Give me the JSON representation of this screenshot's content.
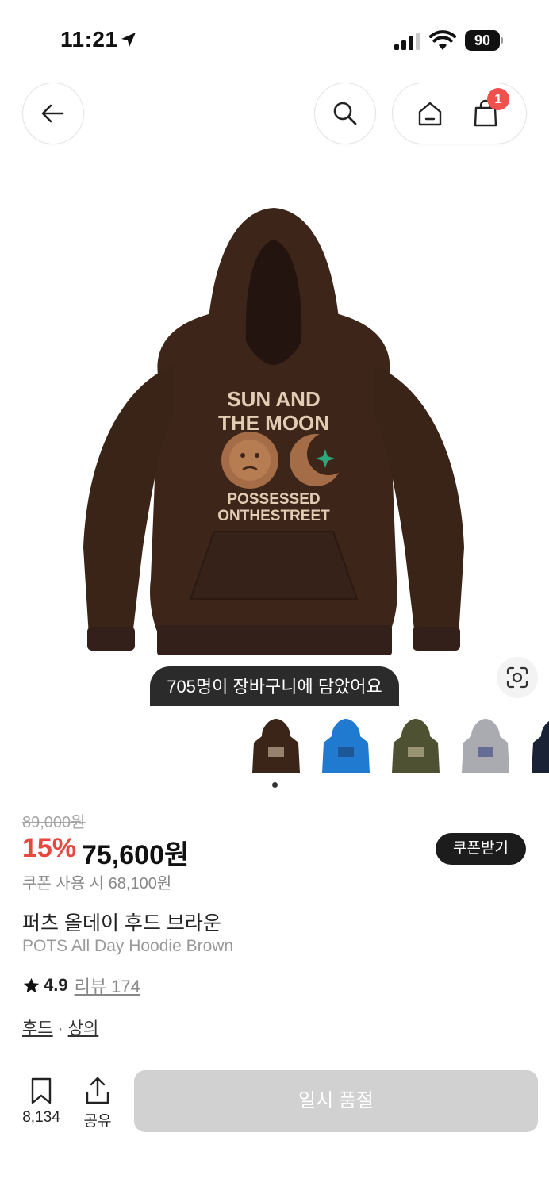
{
  "status_bar": {
    "time": "11:21",
    "battery": "90"
  },
  "nav": {
    "cart_badge": "1"
  },
  "product": {
    "cart_count_notice": "705명이 장바구니에 담았어요",
    "thumbnail_colors": [
      "#3b2519",
      "#1f7ad0",
      "#4e5233",
      "#a9abb0",
      "#1a2236"
    ],
    "selected_image_index": 0,
    "original_price": "89,000원",
    "discount_rate": "15%",
    "sale_price": "75,600원",
    "coupon_button": "쿠폰받기",
    "coupon_price": "쿠폰 사용 시 68,100원",
    "name_ko": "퍼츠 올데이 후드 브라운",
    "name_en": "POTS All Day Hoodie Brown",
    "rating": "4.9",
    "review_label": "리뷰 174",
    "categories": [
      "후드",
      "상의"
    ],
    "category_separator": "·",
    "print_text": {
      "line1": "SUN AND",
      "line2": "THE MOON",
      "line3": "POSSESSED",
      "line4": "ONTHESTREET"
    }
  },
  "bottom_bar": {
    "bookmark_count": "8,134",
    "share_label": "공유",
    "soldout_label": "일시 품절"
  },
  "colors": {
    "hoodie_brown": "#3d2519",
    "discount_red": "#e8463e",
    "badge_red": "#f0514d",
    "print_beige": "#e2cdb4",
    "sun_tan": "#a56d47",
    "star_green": "#2ea67c",
    "disabled_gray": "#d1d1d1"
  }
}
